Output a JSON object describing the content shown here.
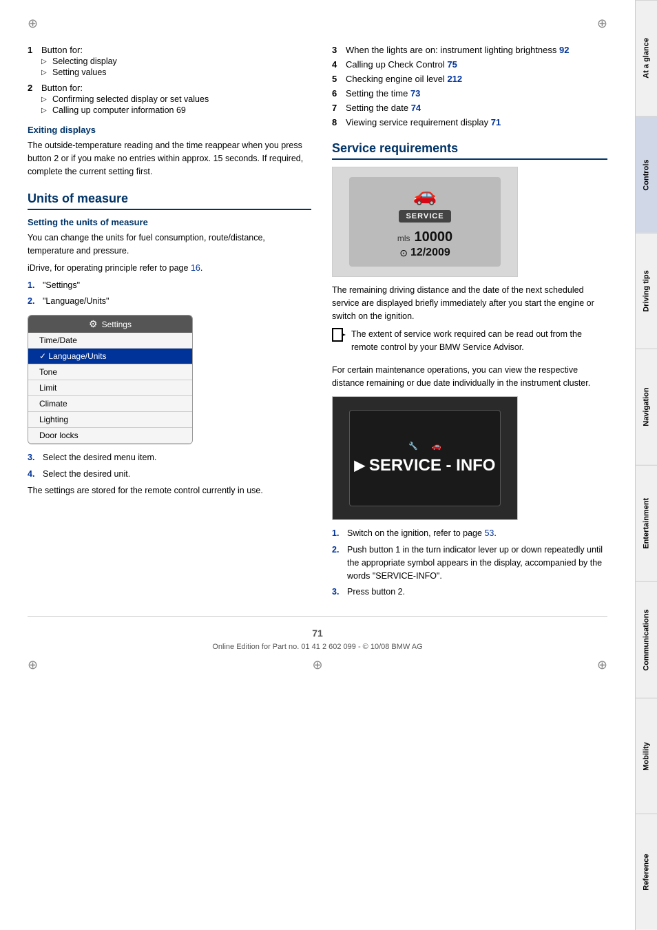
{
  "page": {
    "number": "71",
    "footer": "Online Edition for Part no. 01 41 2 602 099 - © 10/08 BMW AG"
  },
  "tabs": [
    {
      "id": "at-a-glance",
      "label": "At a glance",
      "active": false
    },
    {
      "id": "controls",
      "label": "Controls",
      "active": true
    },
    {
      "id": "driving-tips",
      "label": "Driving tips",
      "active": false
    },
    {
      "id": "navigation",
      "label": "Navigation",
      "active": false
    },
    {
      "id": "entertainment",
      "label": "Entertainment",
      "active": false
    },
    {
      "id": "communications",
      "label": "Communications",
      "active": false
    },
    {
      "id": "mobility",
      "label": "Mobility",
      "active": false
    },
    {
      "id": "reference",
      "label": "Reference",
      "active": false
    }
  ],
  "left_col": {
    "intro_list": [
      {
        "num": "1",
        "label": "Button for:",
        "sub": [
          "Selecting display",
          "Setting values"
        ]
      },
      {
        "num": "2",
        "label": "Button for:",
        "sub": [
          "Confirming selected display or set values",
          "Calling up computer information   69"
        ]
      }
    ],
    "exiting_displays": {
      "heading": "Exiting displays",
      "body": "The outside-temperature reading and the time reappear when you press button 2 or if you make no entries within approx. 15 seconds. If required, complete the current setting first."
    },
    "units_of_measure": {
      "heading": "Units of measure",
      "sub_heading": "Setting the units of measure",
      "intro": "You can change the units for fuel consumption, route/distance, temperature and pressure.",
      "idrive_note": "iDrive, for operating principle refer to page 16.",
      "steps": [
        {
          "num": "1.",
          "text": "\"Settings\""
        },
        {
          "num": "2.",
          "text": "\"Language/Units\""
        }
      ],
      "menu": {
        "title": "Settings",
        "items": [
          {
            "label": "Time/Date",
            "selected": false
          },
          {
            "label": "Language/Units",
            "selected": true
          },
          {
            "label": "Tone",
            "selected": false
          },
          {
            "label": "Limit",
            "selected": false
          },
          {
            "label": "Climate",
            "selected": false
          },
          {
            "label": "Lighting",
            "selected": false
          },
          {
            "label": "Door locks",
            "selected": false
          }
        ]
      },
      "steps2": [
        {
          "num": "3.",
          "text": "Select the desired menu item."
        },
        {
          "num": "4.",
          "text": "Select the desired unit."
        }
      ],
      "conclusion": "The settings are stored for the remote control currently in use."
    }
  },
  "right_col": {
    "toc_items": [
      {
        "num": "3",
        "text": "When the lights are on: instrument lighting brightness",
        "page_ref": "92"
      },
      {
        "num": "4",
        "text": "Calling up Check Control",
        "page_ref": "75"
      },
      {
        "num": "5",
        "text": "Checking engine oil level",
        "page_ref": "212"
      },
      {
        "num": "6",
        "text": "Setting the time",
        "page_ref": "73"
      },
      {
        "num": "7",
        "text": "Setting the date",
        "page_ref": "74"
      },
      {
        "num": "8",
        "text": "Viewing service requirement display",
        "page_ref": "71"
      }
    ],
    "service_requirements": {
      "heading": "Service requirements",
      "image1_caption": "",
      "service_badge": "SERVICE",
      "service_reading": "10000",
      "service_date": "12/2009",
      "service_unit": "mls",
      "description": "The remaining driving distance and the date of the next scheduled service are displayed briefly immediately after you start the engine or switch on the ignition.",
      "tip": "The extent of service work required can be read out from the remote control by your BMW Service Advisor.",
      "maintenance_note": "For certain maintenance operations, you can view the respective distance remaining or due date individually in the instrument cluster.",
      "service_info_display": "SERVICE - INFO",
      "steps": [
        {
          "num": "1.",
          "text": "Switch on the ignition, refer to page 53."
        },
        {
          "num": "2.",
          "text": "Push button 1 in the turn indicator lever up or down repeatedly until the appropriate symbol appears in the display, accompanied by the words \"SERVICE-INFO\"."
        },
        {
          "num": "3.",
          "text": "Press button 2."
        }
      ]
    }
  }
}
